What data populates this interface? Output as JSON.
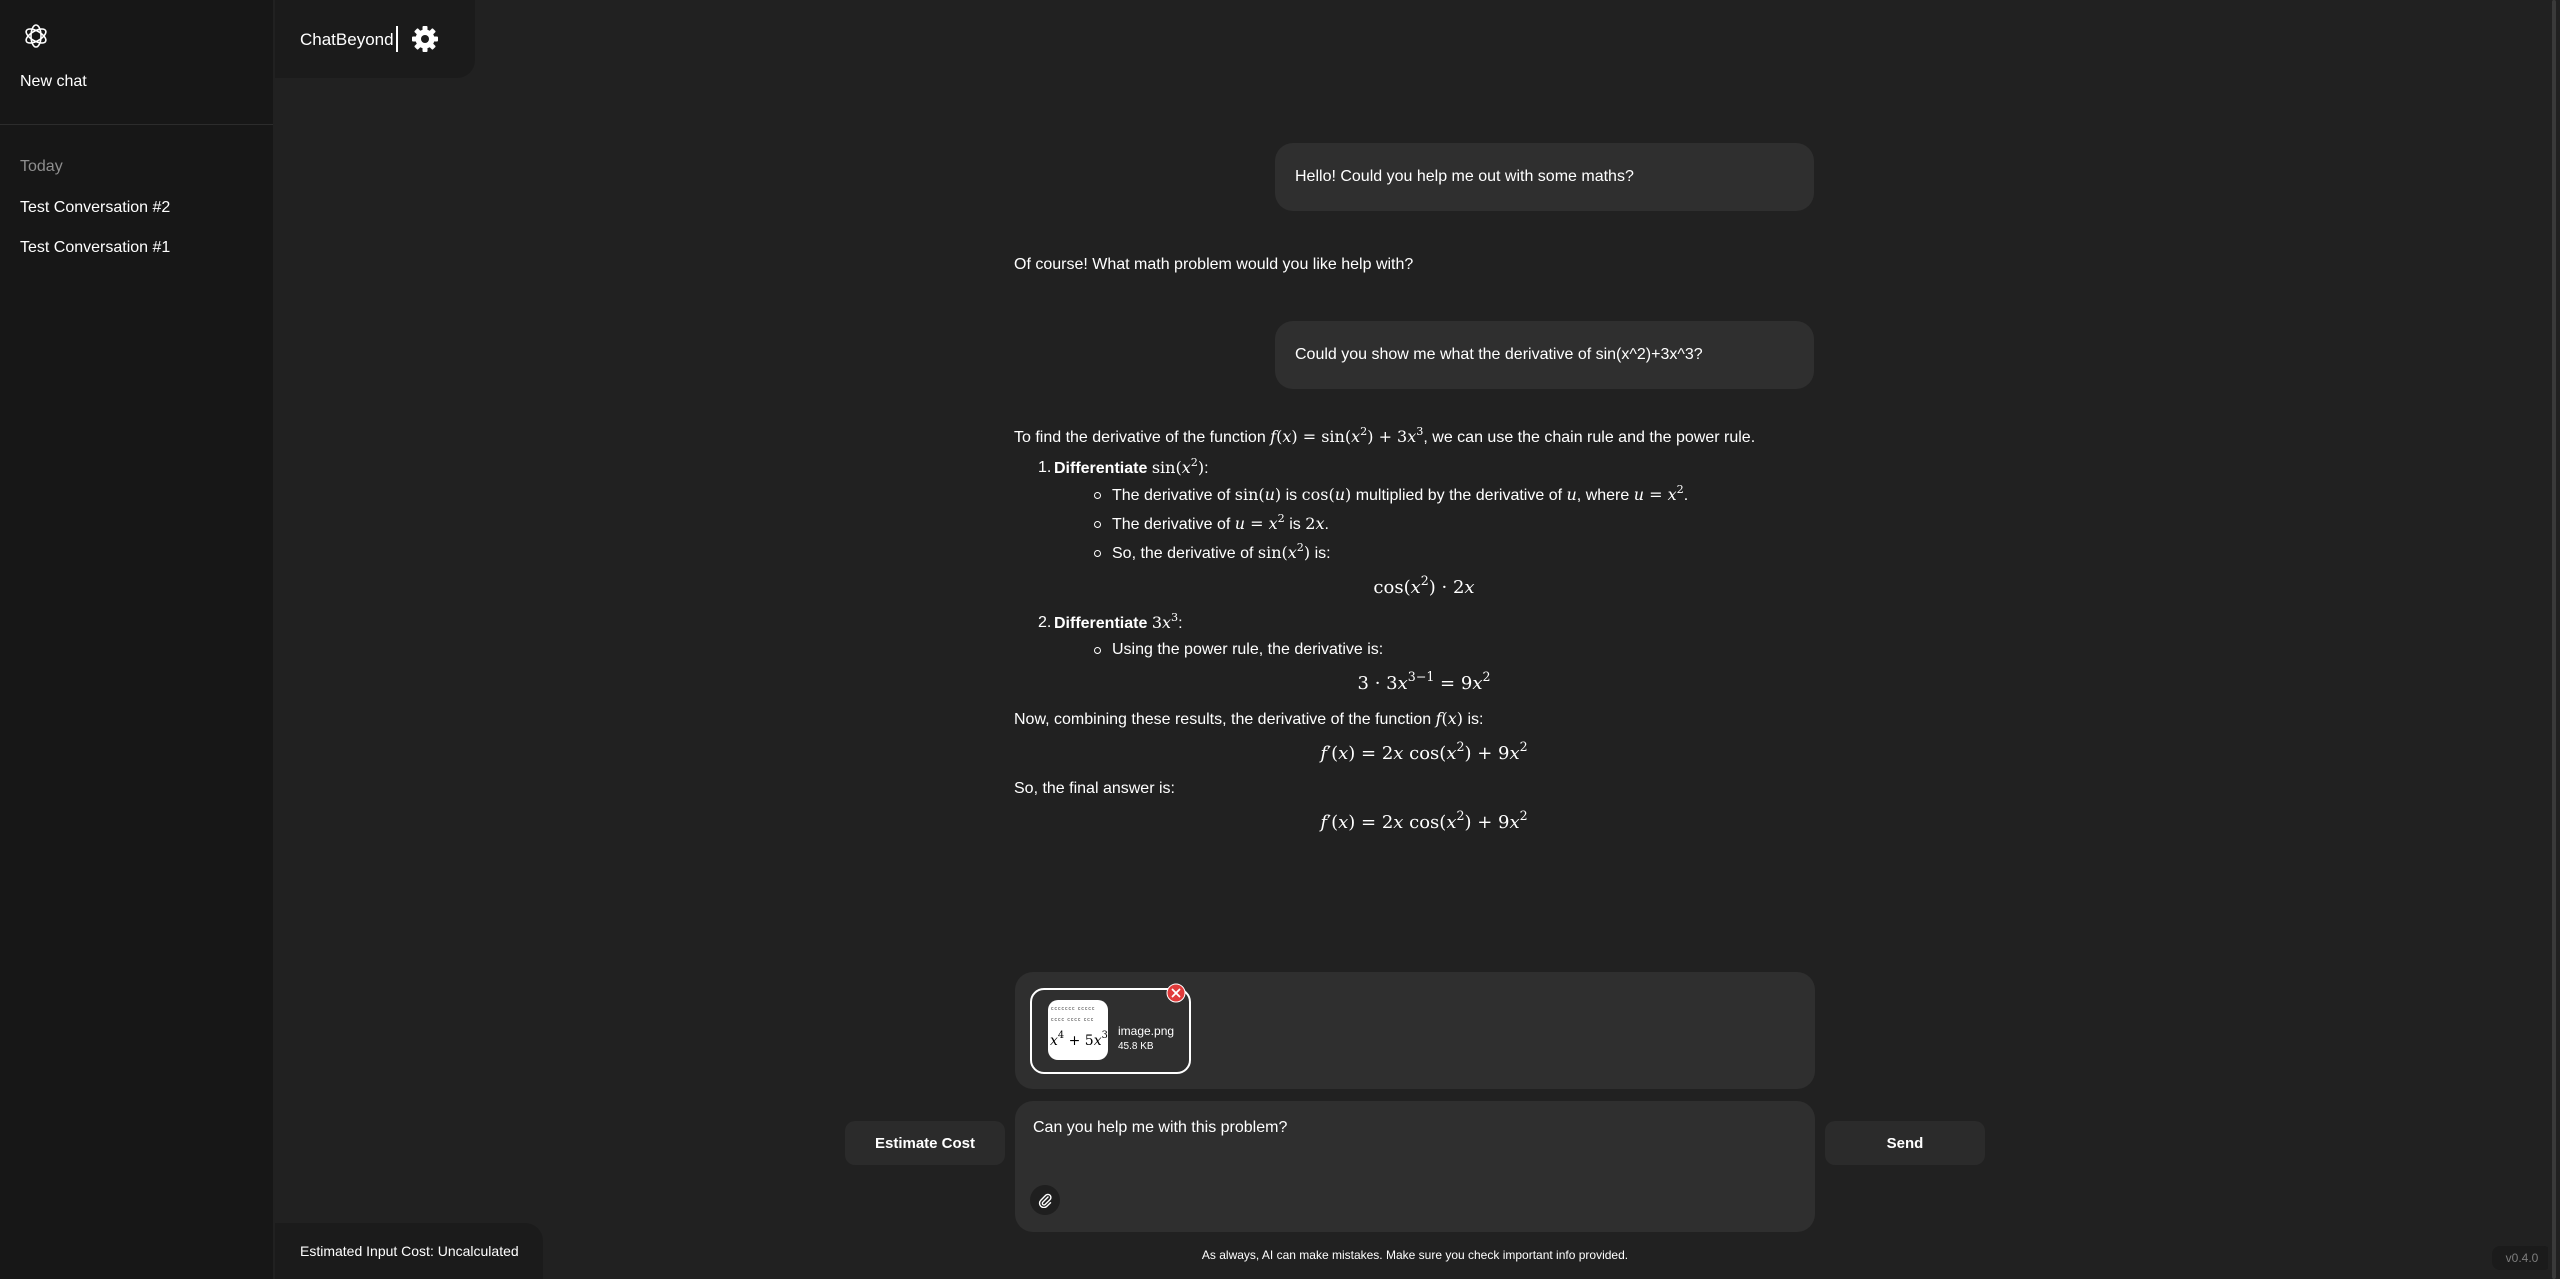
{
  "sidebar": {
    "new_chat": "New chat",
    "section_today": "Today",
    "conversations": [
      "Test Conversation #2",
      "Test Conversation #1"
    ]
  },
  "header": {
    "title": "ChatBeyond"
  },
  "messages": {
    "user_1": "Hello! Could you help me out with some maths?",
    "assistant_1": "Of course! What math problem would you like help with?",
    "user_2": "Could you show me what the derivative of sin(x^2)+3x^3?",
    "assistant_2": {
      "intro_before": "To find the derivative of the function",
      "intro_after": ", we can use the chain rule and the power rule.",
      "step1_title": "Differentiate",
      "step1_bullet1_a": "The derivative of",
      "step1_bullet1_b": "is",
      "step1_bullet1_c": "multiplied by the derivative of",
      "step1_bullet1_d": ", where",
      "step1_bullet2_a": "The derivative of",
      "step1_bullet2_b": "is",
      "step1_bullet3_a": "So, the derivative of",
      "step1_bullet3_b": "is:",
      "step2_title": "Differentiate",
      "step2_bullet1": "Using the power rule, the derivative is:",
      "combine_before": "Now, combining these results, the derivative of the function",
      "combine_after": "is:",
      "final_label": "So, the final answer is:"
    }
  },
  "attachment": {
    "file_name": "image.png",
    "file_size": "45.8 KB"
  },
  "input": {
    "value": "Can you help me with this problem?"
  },
  "buttons": {
    "estimate_cost": "Estimate Cost",
    "send": "Send"
  },
  "footer": {
    "estimated_cost": "Estimated Input Cost: Uncalculated",
    "disclaimer": "As always, AI can make mistakes. Make sure you check important info provided.",
    "version": "v0.4.0"
  }
}
